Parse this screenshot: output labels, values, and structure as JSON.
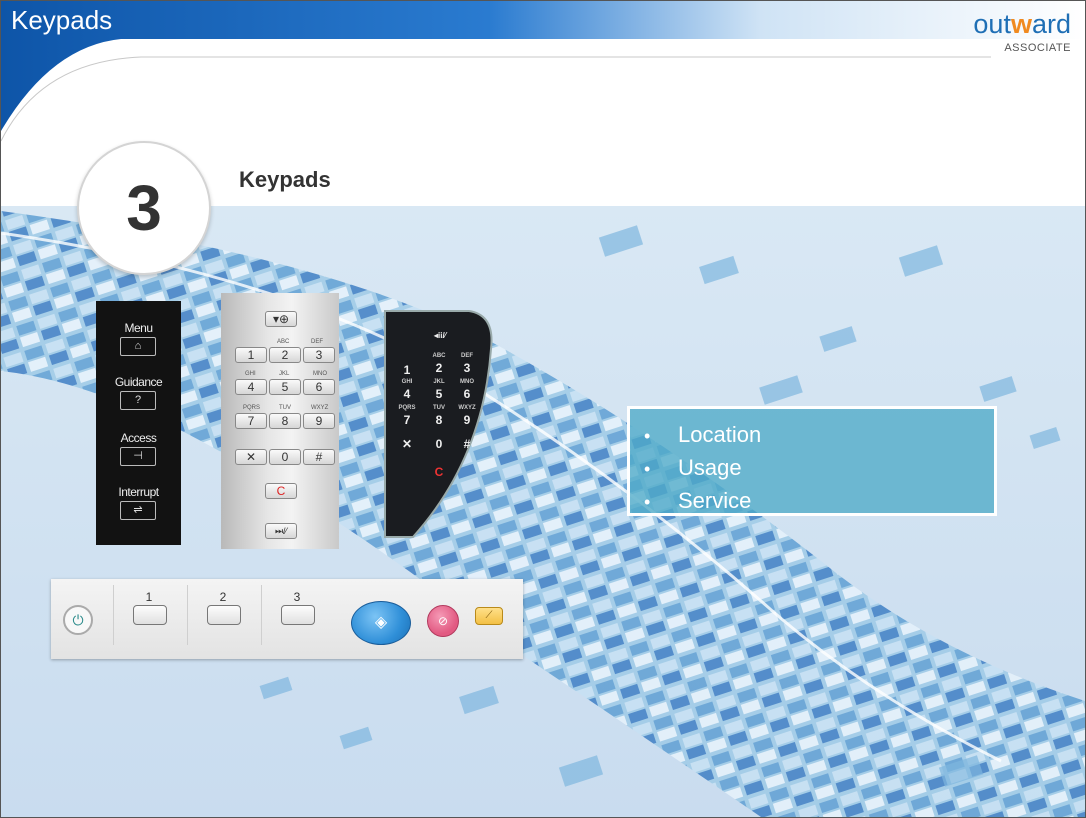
{
  "header": {
    "title": "Keypads",
    "brand": {
      "pre": "out",
      "mark": "w",
      "post": "ard",
      "sub": "ASSOCIATE"
    }
  },
  "section": {
    "number": "3",
    "title": "Keypads"
  },
  "bullets": [
    "Location",
    "Usage",
    "Service"
  ],
  "keypad_black": {
    "labels": [
      "Menu",
      "Guidance",
      "Access",
      "Interrupt"
    ],
    "guidance_glyph": "?"
  },
  "keypad_silver": {
    "top_key": "▾⊕",
    "keys": [
      "1",
      "2",
      "3",
      "4",
      "5",
      "6",
      "7",
      "8",
      "9",
      "✕",
      "0",
      "#"
    ],
    "letters": [
      "ABC",
      "DEF",
      "GHI",
      "JKL",
      "MNO",
      "PQRS",
      "TUV",
      "WXYZ"
    ],
    "clear": "C",
    "bottom_key": "⏭/​⁄"
  },
  "keypad_curved": {
    "top_key": "◂ii/⁄",
    "keys": [
      "1",
      "2",
      "3",
      "4",
      "5",
      "6",
      "7",
      "8",
      "9",
      "✕",
      "0",
      "#"
    ],
    "letters": [
      "ABC",
      "DEF",
      "GHI",
      "JKL",
      "MNO",
      "PQRS",
      "TUV",
      "WXYZ"
    ],
    "clear": "C"
  },
  "control_strip": {
    "slots": [
      "1",
      "2",
      "3"
    ]
  },
  "colors": {
    "header_blue": "#1565b0",
    "bullet_box": "#50aac8",
    "start_button": "#2f8fd8",
    "stop_button": "#e25a82",
    "reset_button": "#f3c045"
  }
}
